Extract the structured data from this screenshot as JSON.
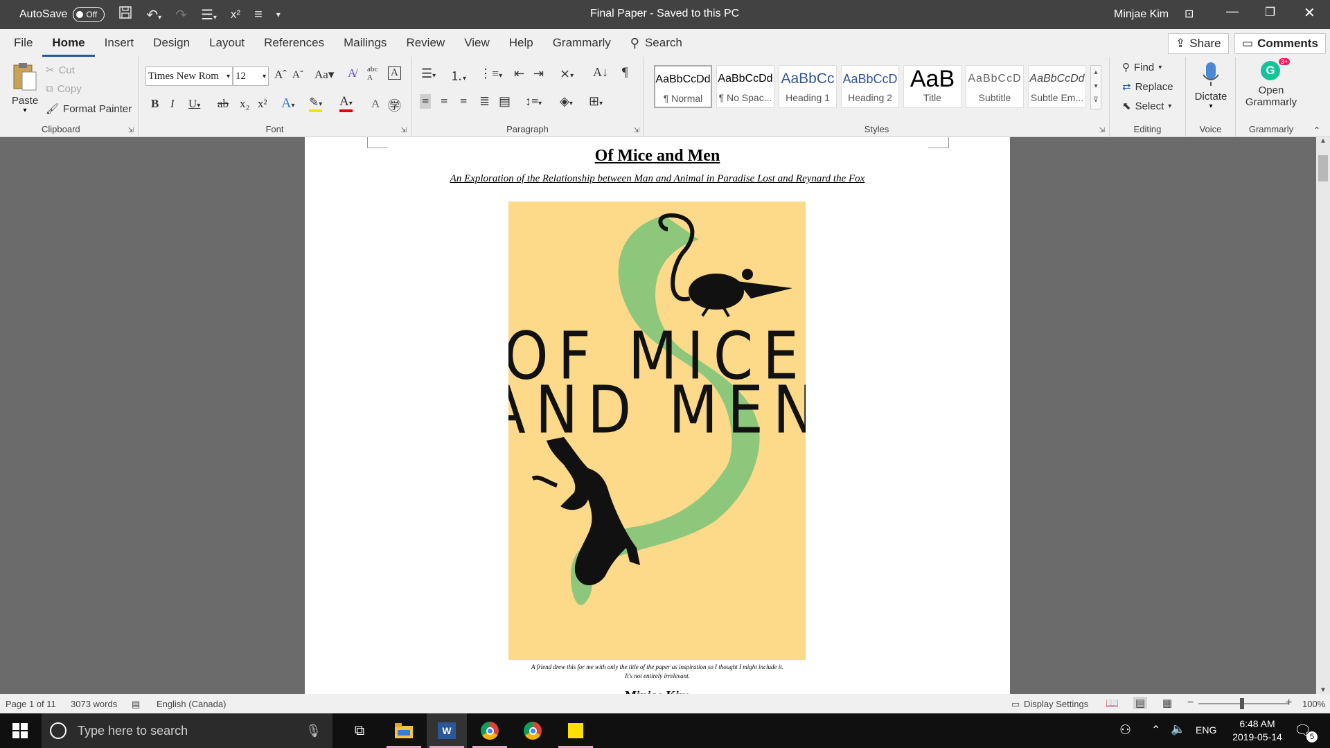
{
  "titlebar": {
    "autosave_label": "AutoSave",
    "autosave_state": "Off",
    "doc_title": "Final Paper",
    "save_status": "Saved to this PC",
    "user": "Minjae Kim"
  },
  "tabs": [
    "File",
    "Home",
    "Insert",
    "Design",
    "Layout",
    "References",
    "Mailings",
    "Review",
    "View",
    "Help",
    "Grammarly"
  ],
  "search_label": "Search",
  "share_label": "Share",
  "comments_label": "Comments",
  "clipboard": {
    "paste": "Paste",
    "cut": "Cut",
    "copy": "Copy",
    "format_painter": "Format Painter",
    "label": "Clipboard"
  },
  "font": {
    "name": "Times New Rom",
    "size": "12",
    "label": "Font"
  },
  "paragraph_label": "Paragraph",
  "styles": {
    "label": "Styles",
    "items": [
      {
        "preview": "AaBbCcDd",
        "name": "¶ Normal"
      },
      {
        "preview": "AaBbCcDd",
        "name": "¶ No Spac..."
      },
      {
        "preview": "AaBbCc",
        "name": "Heading 1"
      },
      {
        "preview": "AaBbCcD",
        "name": "Heading 2"
      },
      {
        "preview": "AaB",
        "name": "Title"
      },
      {
        "preview": "AaBbCcD",
        "name": "Subtitle"
      },
      {
        "preview": "AaBbCcDd",
        "name": "Subtle Em..."
      }
    ]
  },
  "editing": {
    "find": "Find",
    "replace": "Replace",
    "select": "Select",
    "label": "Editing"
  },
  "voice": {
    "dictate": "Dictate",
    "label": "Voice"
  },
  "grammarly": {
    "open_line1": "Open",
    "open_line2": "Grammarly",
    "badge": "3+",
    "label": "Grammarly"
  },
  "document": {
    "title": "Of Mice and Men",
    "subtitle": "An Exploration of the Relationship between Man and Animal in Paradise Lost and Reynard the Fox",
    "poster_line1": "OF MICE",
    "poster_line2": "AND MEN",
    "caption_line1": "A friend drew this for me with only the title of the paper as inspiration so I thought I might include it.",
    "caption_line2": "It's not entirely irrelevant.",
    "author_partial": "Minjae Kim"
  },
  "status": {
    "page": "Page 1 of 11",
    "words": "3073 words",
    "language": "English (Canada)",
    "display_settings": "Display Settings",
    "zoom": "100%"
  },
  "taskbar": {
    "search_placeholder": "Type here to search",
    "lang": "ENG",
    "time": "6:48 AM",
    "date": "2019-05-14",
    "notifications": "5"
  },
  "colors": {
    "poster_bg": "#fdd98a",
    "poster_green": "#8dc77b",
    "accent": "#2b579a"
  }
}
